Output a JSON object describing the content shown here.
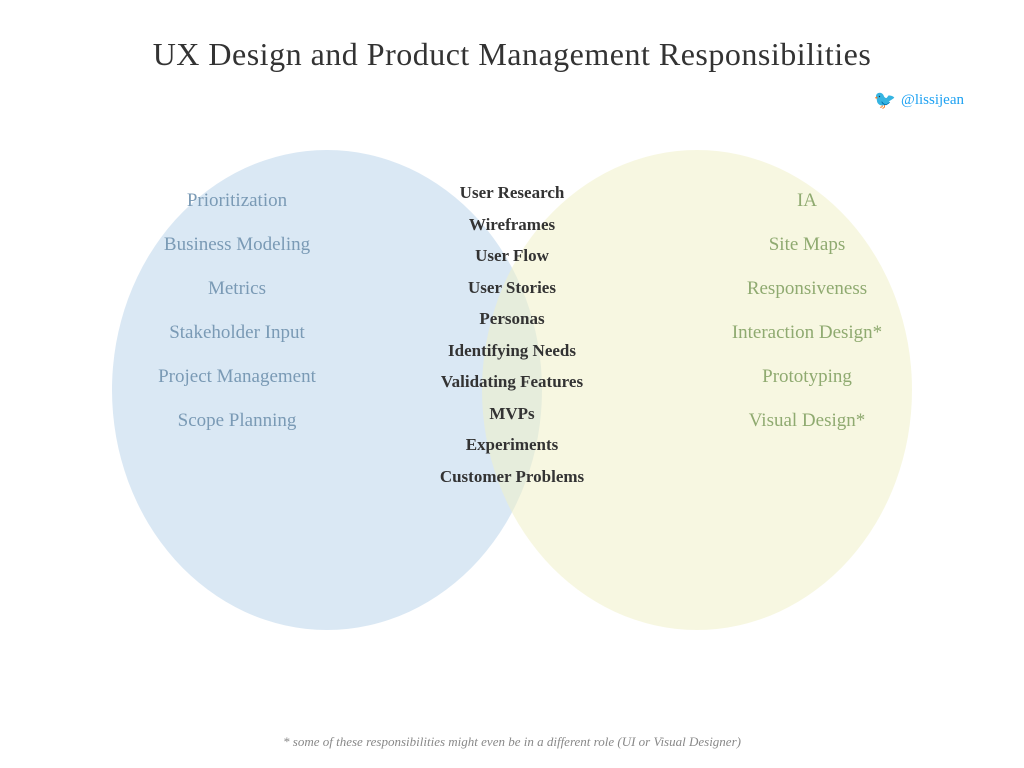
{
  "title": "UX Design and Product Management Responsibilities",
  "twitter": {
    "handle": "@lissijean"
  },
  "left_circle": {
    "items": [
      "Prioritization",
      "Business Modeling",
      "Metrics",
      "Stakeholder Input",
      "Project Management",
      "Scope Planning"
    ]
  },
  "right_circle": {
    "items": [
      "IA",
      "Site Maps",
      "Responsiveness",
      "Interaction Design*",
      "Prototyping",
      "Visual Design*"
    ]
  },
  "center_items": [
    "User Research",
    "Wireframes",
    "User Flow",
    "User Stories",
    "Personas",
    "Identifying Needs",
    "Validating Features",
    "MVPs",
    "Experiments",
    "Customer Problems"
  ],
  "footnote": "* some of these responsibilities might even be in a different role (UI or Visual Designer)"
}
